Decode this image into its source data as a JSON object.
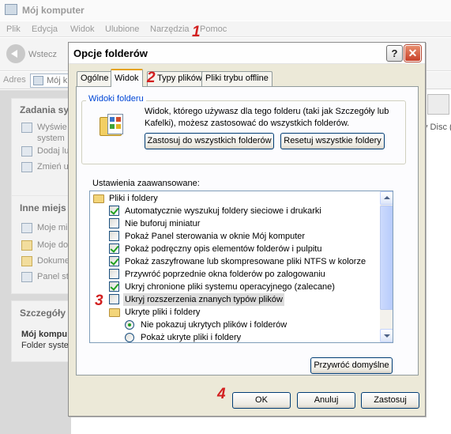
{
  "explorer": {
    "title": "Mój komputer",
    "menu": [
      "Plik",
      "Edycja",
      "Widok",
      "Ulubione",
      "Narzędzia",
      "Pomoc"
    ],
    "back_label": "Wstecz",
    "address_label": "Adres",
    "address_value": "Mój k",
    "panels": [
      {
        "title": "Zadania sy",
        "links": [
          "Wyświe",
          "system",
          "Dodaj lu",
          "Zmień u"
        ]
      },
      {
        "title": "Inne miejs",
        "links": [
          "Moje mi",
          "Moje do",
          "Dokume",
          "Panel st"
        ]
      },
      {
        "title": "Szczegóły"
      }
    ],
    "details_name": "Mój kompu",
    "details_type": "Folder syste",
    "drive_label": "y Disc (",
    "dvd_icon": "dvd-drive-icon"
  },
  "dialog": {
    "title": "Opcje folderów",
    "help_label": "?",
    "close_label": "✕",
    "tabs": [
      "Ogólne",
      "Widok",
      "Typy plików",
      "Pliki trybu offline"
    ],
    "active_tab": "Widok",
    "folder_views": {
      "legend": "Widoki folderu",
      "description": "Widok, którego używasz dla tego folderu (taki jak Szczegóły lub Kafelki), możesz zastosować do wszystkich folderów.",
      "apply_all_label": "Zastosuj do wszystkich folderów",
      "reset_all_label": "Resetuj wszystkie foldery"
    },
    "advanced_label": "Ustawienia zaawansowane:",
    "tree": [
      {
        "type": "folder",
        "label": "Pliki i foldery"
      },
      {
        "type": "checkbox",
        "checked": true,
        "label": "Automatycznie wyszukuj foldery sieciowe i drukarki"
      },
      {
        "type": "checkbox",
        "checked": false,
        "label": "Nie buforuj miniatur"
      },
      {
        "type": "checkbox",
        "checked": false,
        "label": "Pokaż Panel sterowania w oknie Mój komputer"
      },
      {
        "type": "checkbox",
        "checked": true,
        "label": "Pokaż podręczny opis elementów folderów i pulpitu"
      },
      {
        "type": "checkbox",
        "checked": true,
        "label": "Pokaż zaszyfrowane lub skompresowane pliki NTFS w kolorze"
      },
      {
        "type": "checkbox",
        "checked": false,
        "label": "Przywróć poprzednie okna folderów po zalogowaniu"
      },
      {
        "type": "checkbox",
        "checked": true,
        "label": "Ukryj chronione pliki systemu operacyjnego (zalecane)"
      },
      {
        "type": "checkbox",
        "checked": false,
        "label": "Ukryj rozszerzenia znanych typów plików",
        "highlighted": true
      },
      {
        "type": "folder",
        "label": "Ukryte pliki i foldery"
      },
      {
        "type": "radio",
        "checked": true,
        "label": "Nie pokazuj ukrytych plików i folderów"
      },
      {
        "type": "radio",
        "checked": false,
        "label": "Pokaż ukryte pliki i foldery"
      }
    ],
    "restore_defaults_label": "Przywróć domyślne",
    "ok_label": "OK",
    "cancel_label": "Anuluj",
    "apply_label": "Zastosuj"
  },
  "annotations": [
    "1",
    "2",
    "3",
    "4"
  ],
  "colors": {
    "marker": "#d21f1f",
    "check": "#21a121",
    "tab_accent": "#e6a31d",
    "legend_text": "#0046d5"
  }
}
